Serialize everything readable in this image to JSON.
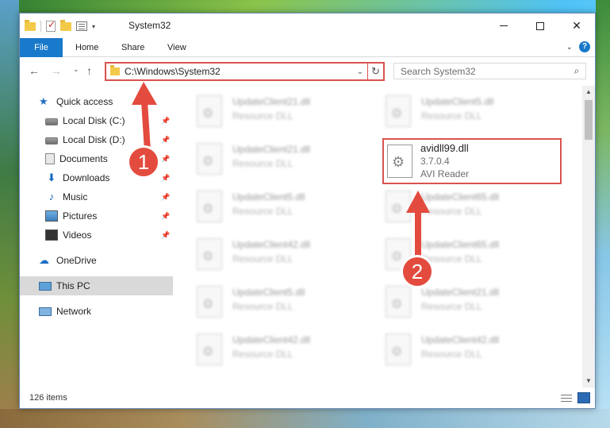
{
  "window": {
    "title": "System32",
    "controls": {
      "minimize": "",
      "maximize": "",
      "close": "✕"
    }
  },
  "ribbon": {
    "tabs": {
      "file": "File",
      "home": "Home",
      "share": "Share",
      "view": "View"
    },
    "help": "?"
  },
  "nav": {
    "back": "←",
    "forward": "→",
    "recent": "⌄",
    "up": "↑"
  },
  "address": {
    "path": "C:\\Windows\\System32",
    "dropdown": "⌄",
    "refresh": "↻"
  },
  "search": {
    "placeholder": "Search System32",
    "icon": "⌕"
  },
  "sidebar": {
    "items": [
      {
        "label": "Quick access",
        "icon": "quick-access-star",
        "pinned": false
      },
      {
        "label": "Local Disk (C:)",
        "icon": "disk",
        "pinned": true
      },
      {
        "label": "Local Disk (D:)",
        "icon": "disk",
        "pinned": true
      },
      {
        "label": "Documents",
        "icon": "documents",
        "pinned": true
      },
      {
        "label": "Downloads",
        "icon": "downloads",
        "pinned": true
      },
      {
        "label": "Music",
        "icon": "music",
        "pinned": true
      },
      {
        "label": "Pictures",
        "icon": "pictures",
        "pinned": true
      },
      {
        "label": "Videos",
        "icon": "videos",
        "pinned": true
      },
      {
        "label": "OneDrive",
        "icon": "onedrive",
        "pinned": false
      },
      {
        "label": "This PC",
        "icon": "this-pc",
        "pinned": false,
        "selected": true
      },
      {
        "label": "Network",
        "icon": "network",
        "pinned": false
      }
    ]
  },
  "files": {
    "left_column": [
      {
        "name": "UpdateClient21.dll",
        "desc": "Resource DLL"
      },
      {
        "name": "UpdateClient21.dll",
        "desc": "Resource DLL"
      },
      {
        "name": "UpdateClient5.dll",
        "desc": "Resource DLL"
      },
      {
        "name": "UpdateClient42.dll",
        "desc": "Resource DLL"
      },
      {
        "name": "UpdateClient5.dll",
        "desc": "Resource DLL"
      },
      {
        "name": "UpdateClient42.dll",
        "desc": "Resource DLL"
      }
    ],
    "right_column": [
      {
        "name": "UpdateClient5.dll",
        "desc": "Resource DLL"
      },
      {
        "name": "UpdateClient65.dll",
        "desc": "Resource DLL"
      },
      {
        "name": "UpdateClient65.dll",
        "desc": "Resource DLL"
      },
      {
        "name": "UpdateClient21.dll",
        "desc": "Resource DLL"
      },
      {
        "name": "UpdateClient42.dll",
        "desc": "Resource DLL"
      }
    ],
    "highlighted": {
      "name": "avidll99.dll",
      "version": "3.7.0.4",
      "desc": "AVI Reader"
    }
  },
  "statusbar": {
    "count": "126 items"
  },
  "annotations": {
    "step1": "1",
    "step2": "2",
    "color": "#e34b3e"
  },
  "colors": {
    "accent": "#1979ca",
    "highlight": "#d9534f"
  }
}
